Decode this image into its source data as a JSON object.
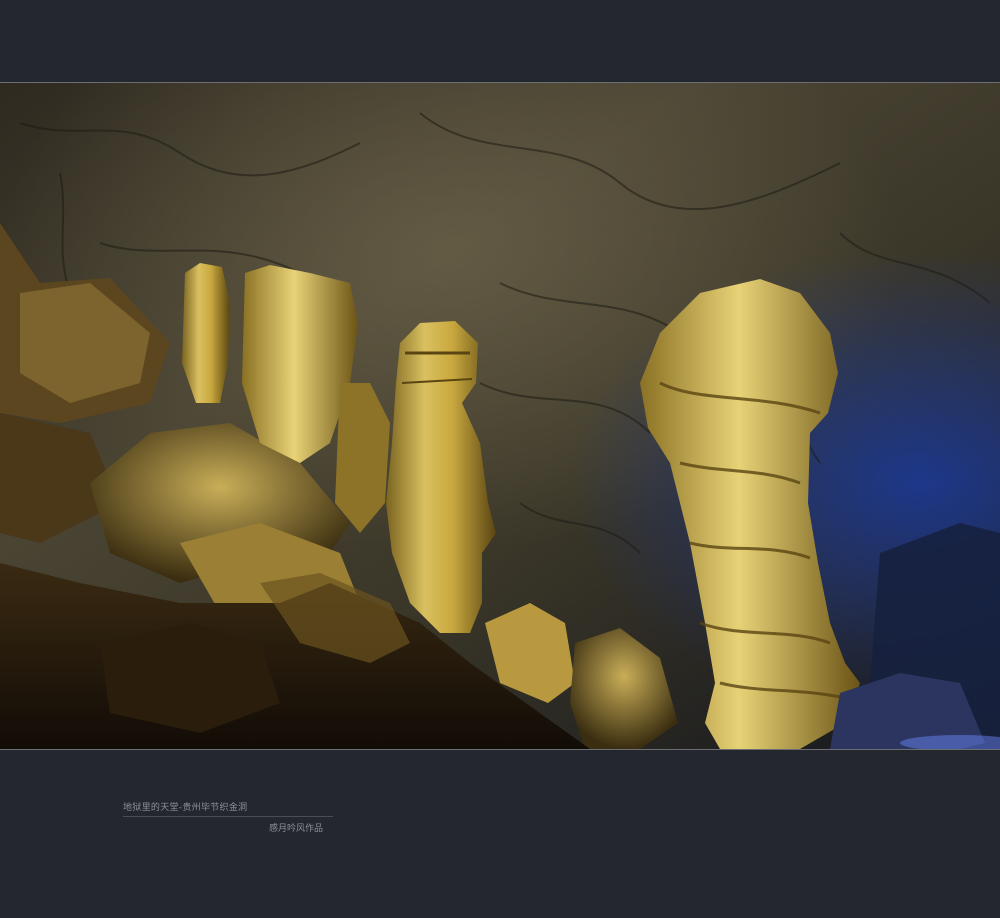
{
  "colors": {
    "background": "#24272e",
    "frame_line": "#6b6e75",
    "caption_text": "#8d9097"
  },
  "photo": {
    "subject": "cave-with-illuminated-stalagmites"
  },
  "caption": {
    "title": "地狱里的天堂-贵州毕节织金洞",
    "author": "感月吟风作品"
  }
}
